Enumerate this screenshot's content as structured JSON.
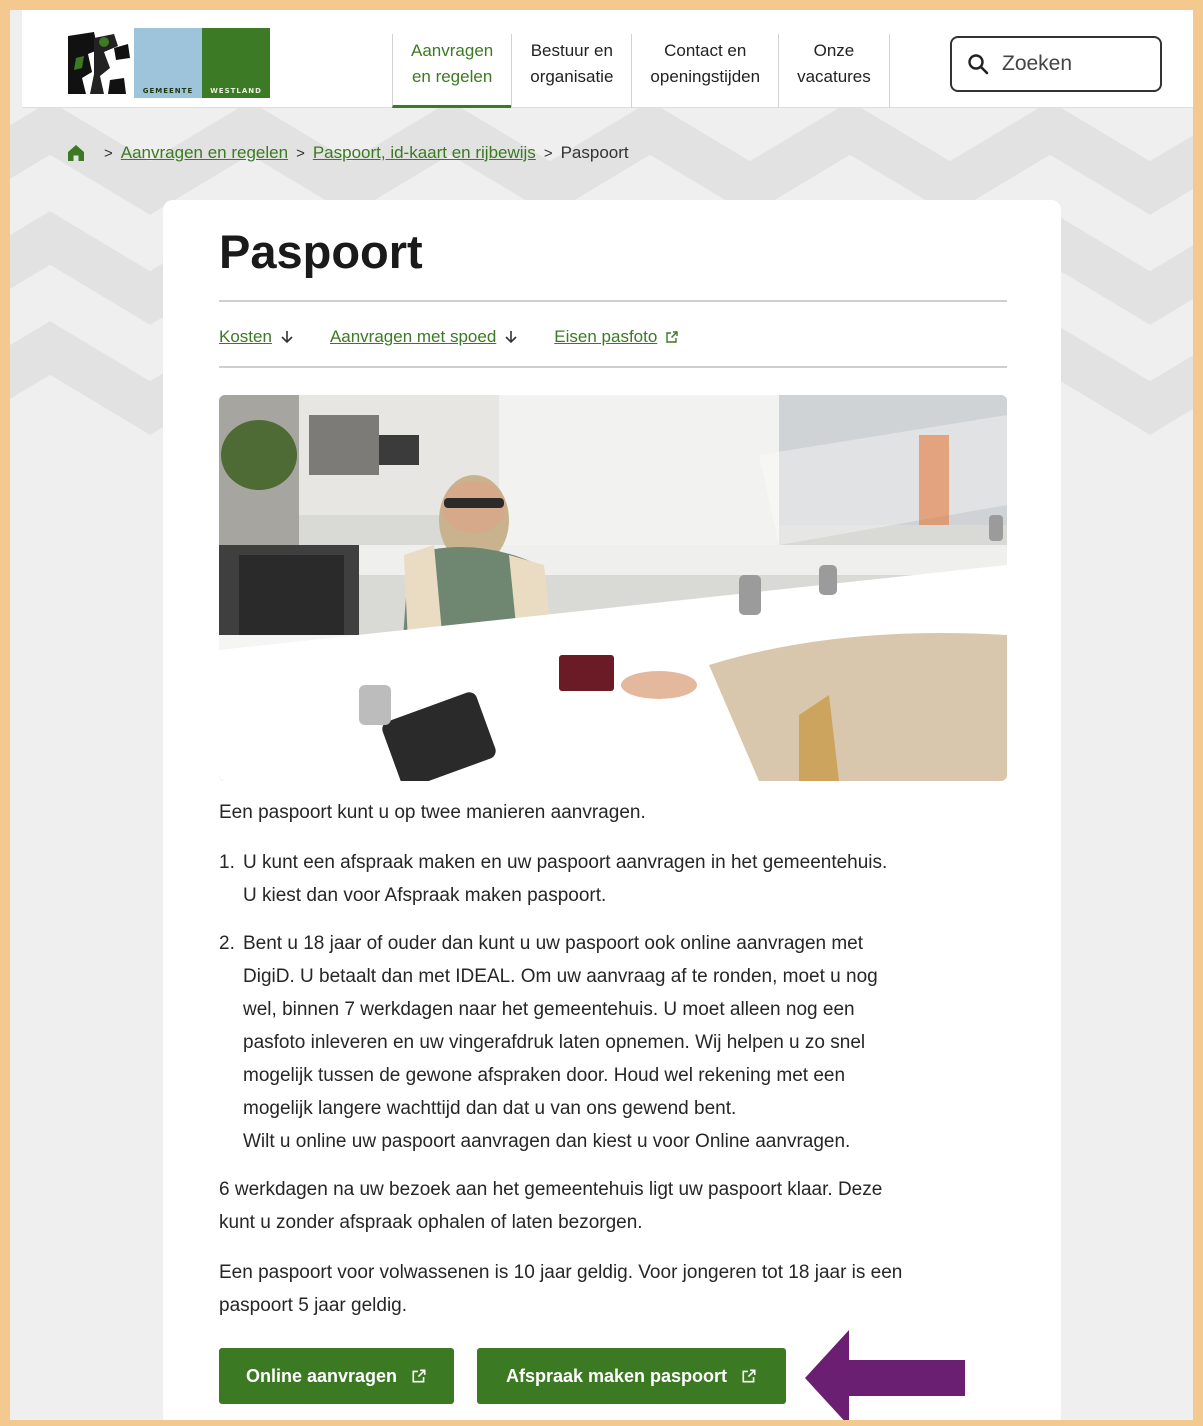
{
  "header": {
    "logo": {
      "word_left": "GEMEENTE",
      "word_right": "WESTLAND",
      "icon": "westland-crest-icon"
    },
    "nav": [
      {
        "line1": "Aanvragen",
        "line2": "en regelen",
        "active": true
      },
      {
        "line1": "Bestuur en",
        "line2": "organisatie",
        "active": false
      },
      {
        "line1": "Contact en",
        "line2": "openingstijden",
        "active": false
      },
      {
        "line1": "Onze",
        "line2": "vacatures",
        "active": false
      }
    ],
    "search": {
      "placeholder": "Zoeken",
      "icon": "search-icon"
    }
  },
  "breadcrumb": {
    "home_icon": "home-icon",
    "items": [
      "Aanvragen en regelen",
      "Paspoort, id-kaart en rijbewijs"
    ],
    "current": "Paspoort"
  },
  "main": {
    "title": "Paspoort",
    "anchors": [
      {
        "label": "Kosten",
        "icon": "arrow-down-icon"
      },
      {
        "label": "Aanvragen met spoed",
        "icon": "arrow-down-icon"
      },
      {
        "label": "Eisen pasfoto",
        "icon": "external-link-icon"
      }
    ],
    "intro": "Een paspoort kunt u op twee manieren aanvragen.",
    "list": [
      {
        "num": "1.",
        "lines": [
          "U kunt een afspraak maken en uw paspoort aanvragen in het gemeentehuis.",
          "U kiest dan voor Afspraak maken paspoort."
        ]
      },
      {
        "num": "2.",
        "lines": [
          "Bent u 18 jaar of ouder dan kunt u uw paspoort ook online aanvragen met",
          "DigiD. U betaalt dan met IDEAL. Om uw aanvraag af te ronden, moet u nog",
          "wel, binnen 7 werkdagen naar het gemeentehuis. U moet alleen nog een",
          "pasfoto inleveren en uw vingerafdruk laten opnemen. Wij helpen u zo snel",
          "mogelijk tussen de gewone afspraken door. Houd wel rekening met een",
          "mogelijk langere wachttijd dan dat u van ons gewend bent.",
          "Wilt u online uw paspoort aanvragen dan kiest u voor Online aanvragen."
        ]
      }
    ],
    "para2": [
      "6 werkdagen na uw bezoek aan het gemeentehuis ligt uw paspoort klaar. Deze",
      "kunt u zonder afspraak ophalen of laten bezorgen."
    ],
    "para3": [
      "Een paspoort voor volwassenen is 10 jaar geldig. Voor jongeren tot 18 jaar is een",
      "paspoort 5 jaar geldig."
    ],
    "buttons": [
      {
        "label": "Online aanvragen",
        "icon": "external-link-icon"
      },
      {
        "label": "Afspraak maken paspoort",
        "icon": "external-link-icon"
      }
    ]
  },
  "colors": {
    "brand_green": "#3b7a22",
    "frame_orange": "#f3c98f",
    "annotation_purple": "#6b1f73",
    "logo_blue": "#9ec4dc"
  }
}
